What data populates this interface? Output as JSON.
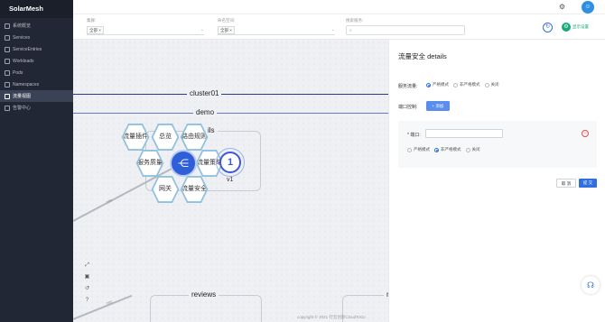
{
  "app": {
    "name": "SolarMesh"
  },
  "sidebar": {
    "items": [
      {
        "label": "系统概览",
        "icon": "monitor-icon",
        "active": false
      },
      {
        "label": "Services",
        "icon": "services-icon",
        "active": false
      },
      {
        "label": "ServiceEntries",
        "icon": "entries-icon",
        "active": false
      },
      {
        "label": "Workloads",
        "icon": "workloads-icon",
        "active": false
      },
      {
        "label": "Pods",
        "icon": "pods-icon",
        "active": false
      },
      {
        "label": "Namespaces",
        "icon": "namespaces-icon",
        "active": false
      },
      {
        "label": "流量视图",
        "icon": "traffic-icon",
        "active": true
      },
      {
        "label": "告警中心",
        "icon": "alert-icon",
        "active": false
      }
    ]
  },
  "topbar": {
    "settings_icon": "gear-icon",
    "avatar_icon": "user-avatar-icon"
  },
  "filters": {
    "cluster": {
      "label": "集群:",
      "tag": "全部 ×"
    },
    "namespace": {
      "label": "命名空间:",
      "tag": "全部 ×"
    },
    "search": {
      "label": "搜索服务:",
      "value": ""
    },
    "display_settings": "显示设置"
  },
  "graph": {
    "cluster_label": "cluster01",
    "namespace_label": "demo",
    "details_box_label": "ils",
    "reviews_box_label": "reviews",
    "right_box_label": "r",
    "hex_menu": [
      "流量插件",
      "总览",
      "路由规则",
      "服务质量",
      "流量策略",
      "网关",
      "流量安全"
    ],
    "center_icon": "share-icon",
    "version_node": {
      "number": "1",
      "label": "v1"
    },
    "edge_label": "http",
    "edge_label_2": "http",
    "tools": [
      "fullscreen-icon",
      "fit-icon",
      "reset-icon",
      "help-icon"
    ],
    "footer": "copyright © 2021 行云创新CloudToGo"
  },
  "panel": {
    "title": "流量安全 details",
    "service_traffic_label": "服务流量:",
    "traffic_modes": [
      {
        "label": "严格模式",
        "selected": true
      },
      {
        "label": "非严格模式",
        "selected": false
      },
      {
        "label": "关闭",
        "selected": false
      }
    ],
    "port_control_label": "端口控制:",
    "add_button": "+ 添加",
    "port_label": "* 端口:",
    "port_value": "",
    "port_modes": [
      {
        "label": "严格模式",
        "selected": false
      },
      {
        "label": "非严格模式",
        "selected": true
      },
      {
        "label": "关闭",
        "selected": false
      }
    ],
    "cancel": "取 消",
    "submit": "提 交"
  },
  "colors": {
    "sidebar": "#212734",
    "primary": "#2f6fe0",
    "accent_green": "#19a974"
  }
}
